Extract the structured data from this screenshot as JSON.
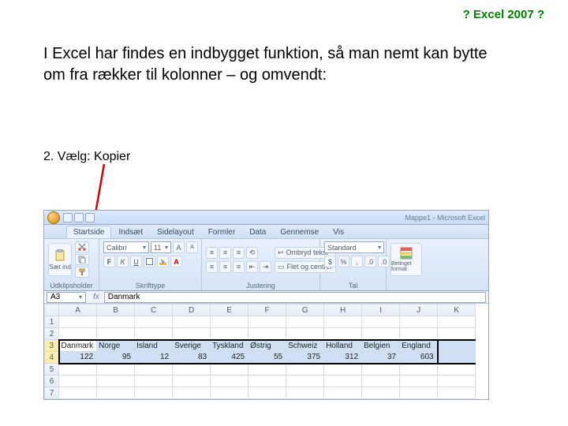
{
  "header": {
    "title": "? Excel 2007 ?"
  },
  "intro": "I Excel har findes en indbygget funktion, så man nemt kan bytte om fra rækker til kolonner – og omvendt:",
  "step": "2. Vælg: Kopier",
  "window": {
    "title": "Mappe1 - Microsoft Excel"
  },
  "tabs": [
    "Startside",
    "Indsæt",
    "Sidelayout",
    "Formler",
    "Data",
    "Gennemse",
    "Vis"
  ],
  "ribbon": {
    "clipboard": {
      "paste": "Sæt ind",
      "label": "Udklipsholder"
    },
    "font": {
      "name": "Calibri",
      "size": "11",
      "label": "Skrifttype",
      "bold": "F",
      "italic": "K",
      "underline": "U"
    },
    "alignment": {
      "wrap": "Ombryd tekst",
      "merge": "Flet og centrer",
      "label": "Justering"
    },
    "number": {
      "format": "Standard",
      "label": "Tal"
    },
    "styles": {
      "cond": "Betinget format"
    }
  },
  "cellref": "A3",
  "formula": "Danmark",
  "chart_data": {
    "type": "table",
    "columns": [
      "A",
      "B",
      "C",
      "D",
      "E",
      "F",
      "G",
      "H",
      "I",
      "J",
      "K"
    ],
    "rows": [
      {
        "n": 1,
        "cells": [
          "",
          "",
          "",
          "",
          "",
          "",
          "",
          "",
          "",
          "",
          ""
        ]
      },
      {
        "n": 2,
        "cells": [
          "",
          "",
          "",
          "",
          "",
          "",
          "",
          "",
          "",
          "",
          ""
        ]
      },
      {
        "n": 3,
        "cells": [
          "Danmark",
          "Norge",
          "Island",
          "Sverige",
          "Tyskland",
          "Østrig",
          "Schweiz",
          "Holland",
          "Belgien",
          "England",
          ""
        ]
      },
      {
        "n": 4,
        "cells": [
          "122",
          "95",
          "12",
          "83",
          "425",
          "55",
          "375",
          "312",
          "37",
          "603",
          ""
        ]
      },
      {
        "n": 5,
        "cells": [
          "",
          "",
          "",
          "",
          "",
          "",
          "",
          "",
          "",
          "",
          ""
        ]
      },
      {
        "n": 6,
        "cells": [
          "",
          "",
          "",
          "",
          "",
          "",
          "",
          "",
          "",
          "",
          ""
        ]
      },
      {
        "n": 7,
        "cells": [
          "",
          "",
          "",
          "",
          "",
          "",
          "",
          "",
          "",
          "",
          ""
        ]
      }
    ],
    "selected_rows": [
      3,
      4
    ],
    "active_cell": "A3"
  }
}
